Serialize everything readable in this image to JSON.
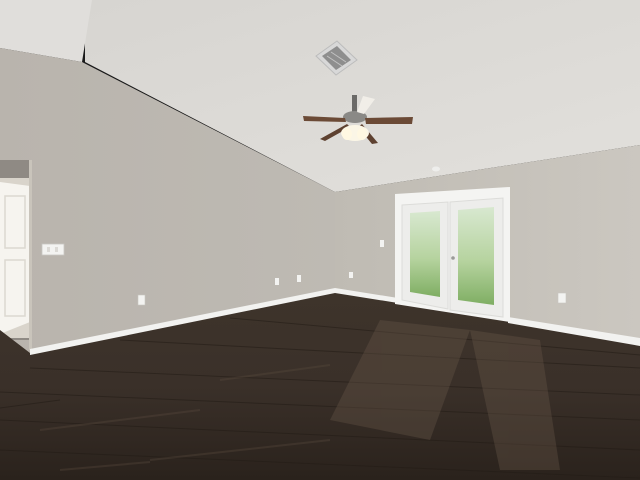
{
  "scene": {
    "description_free": true,
    "colors": {
      "ceiling": "#dcdad6",
      "ceiling_shadow": "#c9c7c3",
      "left_wall": "#bdb9b2",
      "back_wall": "#c8c4bc",
      "baseboard": "#f2f2f0",
      "floor_dark": "#2e261f",
      "floor_mid": "#4a3f35",
      "door_frame": "#f4f4f2",
      "glass": "#b9d7a8",
      "fan_blade": "#6b4a36",
      "fan_light": "#f5eed8",
      "vent": "#d8d8d8",
      "hall_door": "#f6f4ef"
    }
  }
}
